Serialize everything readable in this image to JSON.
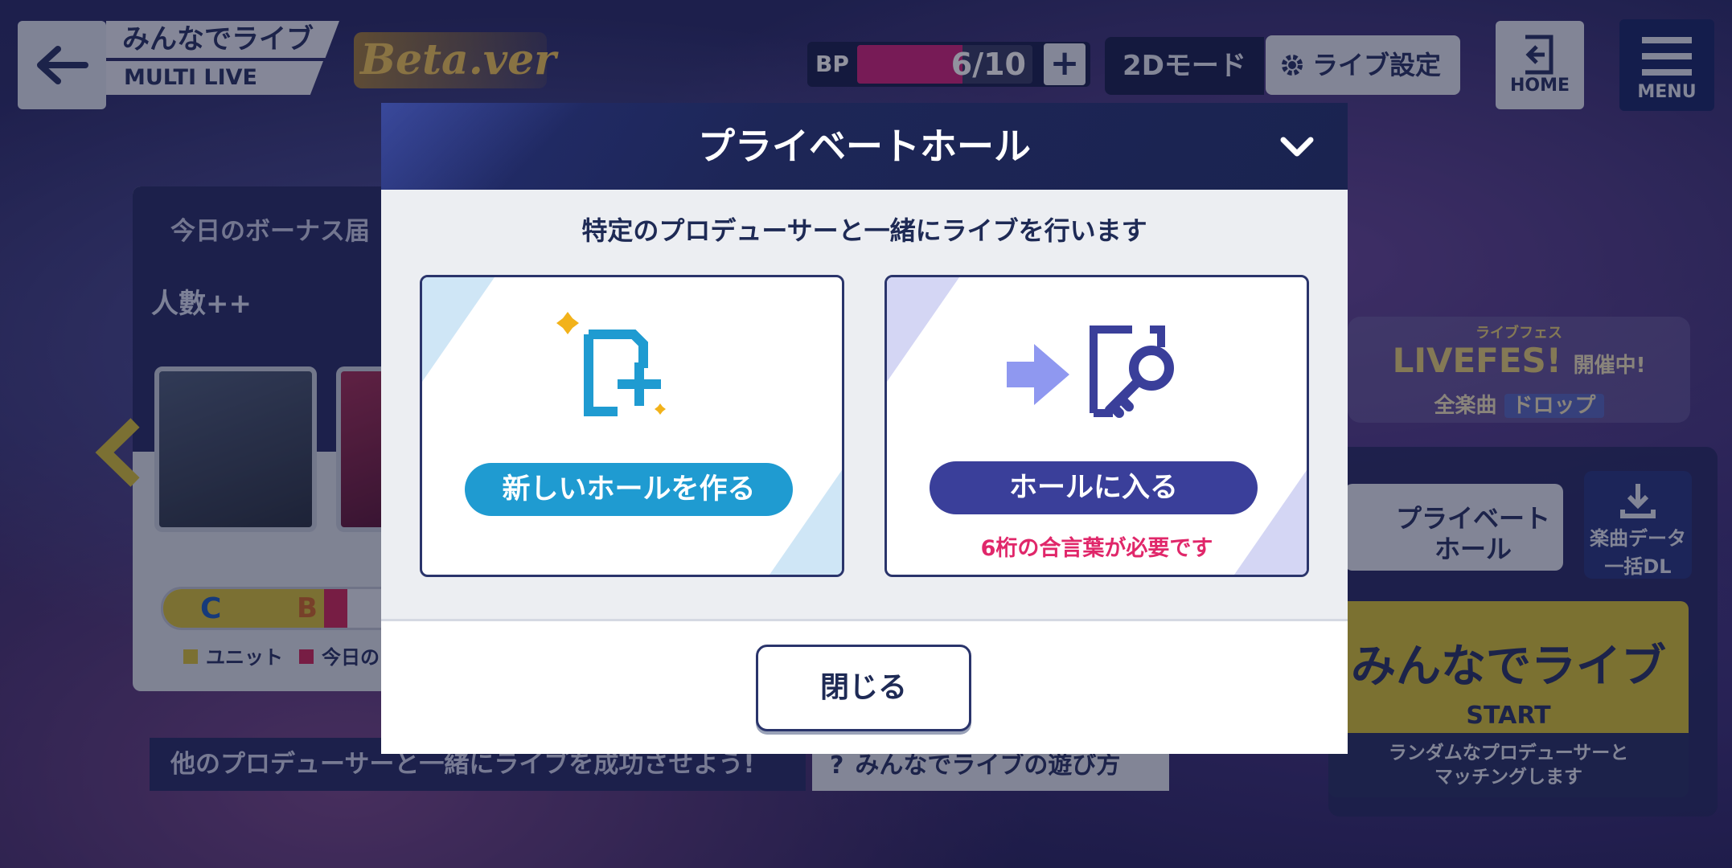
{
  "header": {
    "title_jp": "みんなでライブ",
    "title_en": "MULTI LIVE",
    "beta": "Beta.ver",
    "bp_label": "BP",
    "bp_value": "6/10",
    "bp_fraction": 0.6,
    "bp_plus": "+",
    "mode_button": "2Dモード",
    "settings_button": "ライブ設定",
    "home_label": "HOME",
    "menu_label": "MENU"
  },
  "left_panel": {
    "bonus_title": "今日のボーナス届",
    "headcount": "人數++",
    "rank_c": "C",
    "rank_b": "B",
    "legend_unit": "ユニット",
    "legend_today": "今日の"
  },
  "bottom": {
    "banner": "他のプロデューサーと一緒にライブを成功させよう!",
    "howto": "みんなでライブの遊び方",
    "howto_icon": "?"
  },
  "right_panel": {
    "fes_top": "ライブフェス",
    "fes_title": "LIVEFES!",
    "fes_open": "開催中!",
    "fes_all": "全楽曲",
    "fes_drop": "ドロップ",
    "private_line1": "プライベート",
    "private_line2": "ホール",
    "dl_line1": "楽曲データ",
    "dl_line2": "一括DL",
    "start_title": "みんなでライブ",
    "start_label": "START",
    "start_sub_line1": "ランダムなプロデューサーと",
    "start_sub_line2": "マッチングします"
  },
  "modal": {
    "title": "プライベートホール",
    "description": "特定のプロデューサーと一緒にライブを行います",
    "create_button": "新しいホールを作る",
    "join_button": "ホールに入る",
    "join_note": "6桁の合言葉が必要です",
    "close_button": "閉じる"
  },
  "colors": {
    "accent_blue": "#1f9bd1",
    "accent_indigo": "#3a3f9a",
    "warning_pink": "#e0276a",
    "navy": "#1e2a55",
    "bp_pink": "#d0277c",
    "start_yellow": "#d7c33a"
  },
  "icons": {
    "back": "arrow-left-icon",
    "gear": "gear-icon",
    "home": "home-exit-icon",
    "menu": "hamburger-icon",
    "collapse": "chevron-down-icon",
    "create": "new-room-plus-icon",
    "join": "arrow-key-room-icon",
    "download": "download-icon"
  }
}
